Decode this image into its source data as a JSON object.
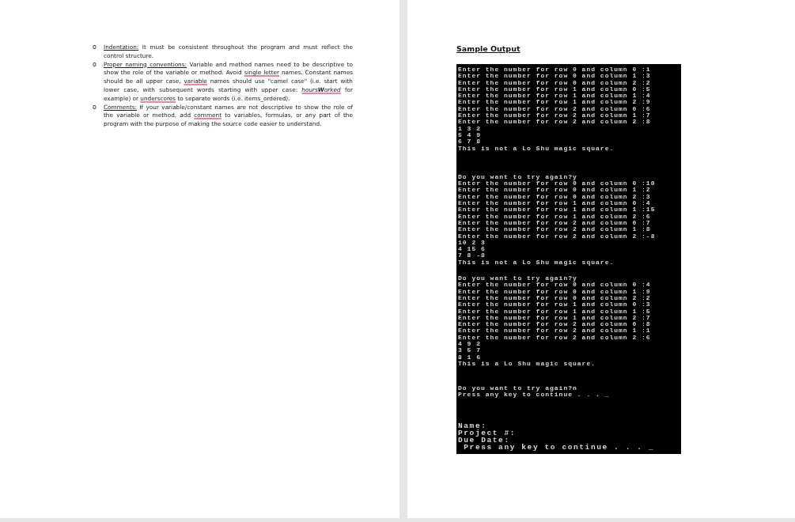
{
  "left_page": {
    "items": [
      {
        "bullet": "o",
        "label": "Indentation:",
        "segments": [
          {
            "text": " It must be consistent throughout the program and must reflect the control structure.",
            "flagged": false
          }
        ]
      },
      {
        "bullet": "o",
        "label": "Proper naming conventions:",
        "segments": [
          {
            "text": " Variable and method names need to be descriptive to show the role of the variable or method. Avoid ",
            "flagged": false
          },
          {
            "text": "single letter",
            "flagged": true
          },
          {
            "text": " names. Constant names should be all upper case, ",
            "flagged": false
          },
          {
            "text": "variable",
            "flagged": true
          },
          {
            "text": " names should use \"camel case\" (i.e. start with lower case, with subsequent words starting with upper case: ",
            "flagged": false
          },
          {
            "text": "hours**W**orked",
            "flagged": true,
            "italic": true
          },
          {
            "text": " for example) or ",
            "flagged": false
          },
          {
            "text": "underscores",
            "flagged": true
          },
          {
            "text": " to separate words (i.e. items_ordered).",
            "flagged": false
          }
        ]
      },
      {
        "bullet": "o",
        "label": "Comments:",
        "segments": [
          {
            "text": "  If your variable/constant names are not descriptive to show the role of the variable or method, add ",
            "flagged": false
          },
          {
            "text": "comment",
            "flagged": true
          },
          {
            "text": " to variables, formulas, or any part of the program with the purpose of making the source code easier to understand.",
            "flagged": false
          }
        ]
      }
    ]
  },
  "right_page": {
    "heading": "Sample Output",
    "console_blocks": [
      {
        "groups": [
          {
            "kind": "normal",
            "lines": [
              "Enter the number for row 0 and column 0 :1",
              "Enter the number for row 0 and column 1 :3",
              "Enter the number for row 0 and column 2 :2",
              "Enter the number for row 1 and column 0 :5",
              "Enter the number for row 1 and column 1 :4",
              "Enter the number for row 1 and column 2 :9",
              "Enter the number for row 2 and column 0 :6",
              "Enter the number for row 2 and column 1 :7",
              "Enter the number for row 2 and column 2 :8",
              "1 3 2",
              "5 4 9",
              "6 7 8",
              "This is not a Lo Shu magic square."
            ]
          }
        ]
      },
      {
        "groups": [
          {
            "kind": "normal",
            "lines": [
              "Do you want to try again?y",
              "Enter the number for row 0 and column 0 :10",
              "Enter the number for row 0 and column 1 :2",
              "Enter the number for row 0 and column 2 :3",
              "Enter the number for row 1 and column 0 :4",
              "Enter the number for row 1 and column 1 :15",
              "Enter the number for row 1 and column 2 :6",
              "Enter the number for row 2 and column 0 :7",
              "Enter the number for row 2 and column 1 :8",
              "Enter the number for row 2 and column 2 :-8",
              "10 2 3",
              "4 15 6",
              "7 8 -8",
              "This is not a Lo Shu magic square."
            ]
          }
        ]
      },
      {
        "groups": [
          {
            "kind": "normal",
            "lines": [
              "Do you want to try again?y",
              "Enter the number for row 0 and column 0 :4",
              "Enter the number for row 0 and column 1 :9",
              "Enter the number for row 0 and column 2 :2",
              "Enter the number for row 1 and column 0 :3",
              "Enter the number for row 1 and column 1 :5",
              "Enter the number for row 1 and column 2 :7",
              "Enter the number for row 2 and column 0 :8",
              "Enter the number for row 2 and column 1 :1",
              "Enter the number for row 2 and column 2 :6",
              "4 9 2",
              "3 5 7",
              "8 1 6",
              "This is a Lo Shu magic square."
            ]
          }
        ]
      },
      {
        "groups": [
          {
            "kind": "normal",
            "lines": [
              "Do you want to try again?n",
              "Press any key to continue . . . _"
            ]
          },
          {
            "kind": "large",
            "lines": [
              "Name:",
              "Project #:",
              "Due Date:",
              " Press any key to continue . . . _"
            ]
          }
        ]
      }
    ]
  }
}
